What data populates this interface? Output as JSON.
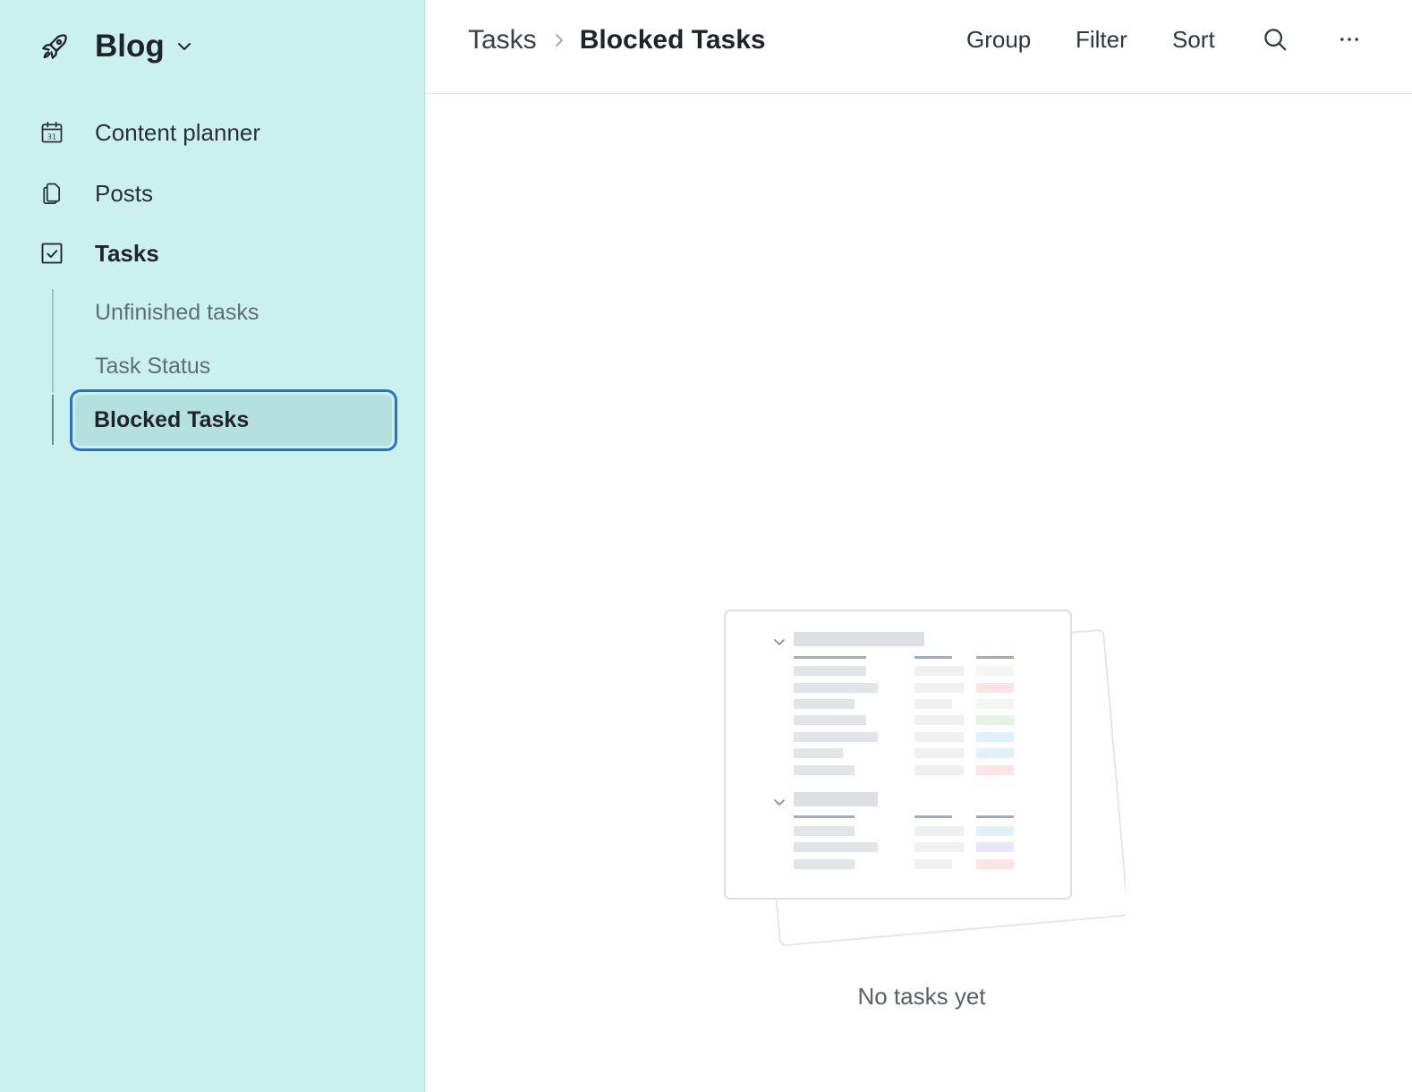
{
  "workspace": {
    "name": "Blog",
    "logo_icon": "rocket-icon",
    "menu_icon": "chevron-down-icon"
  },
  "sidebar": {
    "items": [
      {
        "label": "Content planner",
        "icon": "calendar-icon"
      },
      {
        "label": "Posts",
        "icon": "documents-icon"
      },
      {
        "label": "Tasks",
        "icon": "checkbox-icon"
      }
    ],
    "subitems": [
      {
        "label": "Unfinished tasks"
      },
      {
        "label": "Task Status"
      },
      {
        "label": "Blocked Tasks"
      }
    ],
    "active_item": "Tasks",
    "selected_subitem": "Blocked Tasks"
  },
  "header": {
    "breadcrumb": {
      "parent": "Tasks",
      "current": "Blocked Tasks"
    },
    "toolbar": {
      "group_label": "Group",
      "filter_label": "Filter",
      "sort_label": "Sort",
      "search_icon": "search-icon",
      "more_icon": "more-horizontal-icon"
    }
  },
  "empty_state": {
    "message": "No tasks yet",
    "illustration": "table-placeholder-illustration"
  },
  "colors": {
    "sidebar_bg": "#cbf1ef",
    "selected_bg": "#b4e1de",
    "focus_ring": "#2b6fd6",
    "text_primary": "#1f2328",
    "text_secondary": "#5f6e70"
  }
}
